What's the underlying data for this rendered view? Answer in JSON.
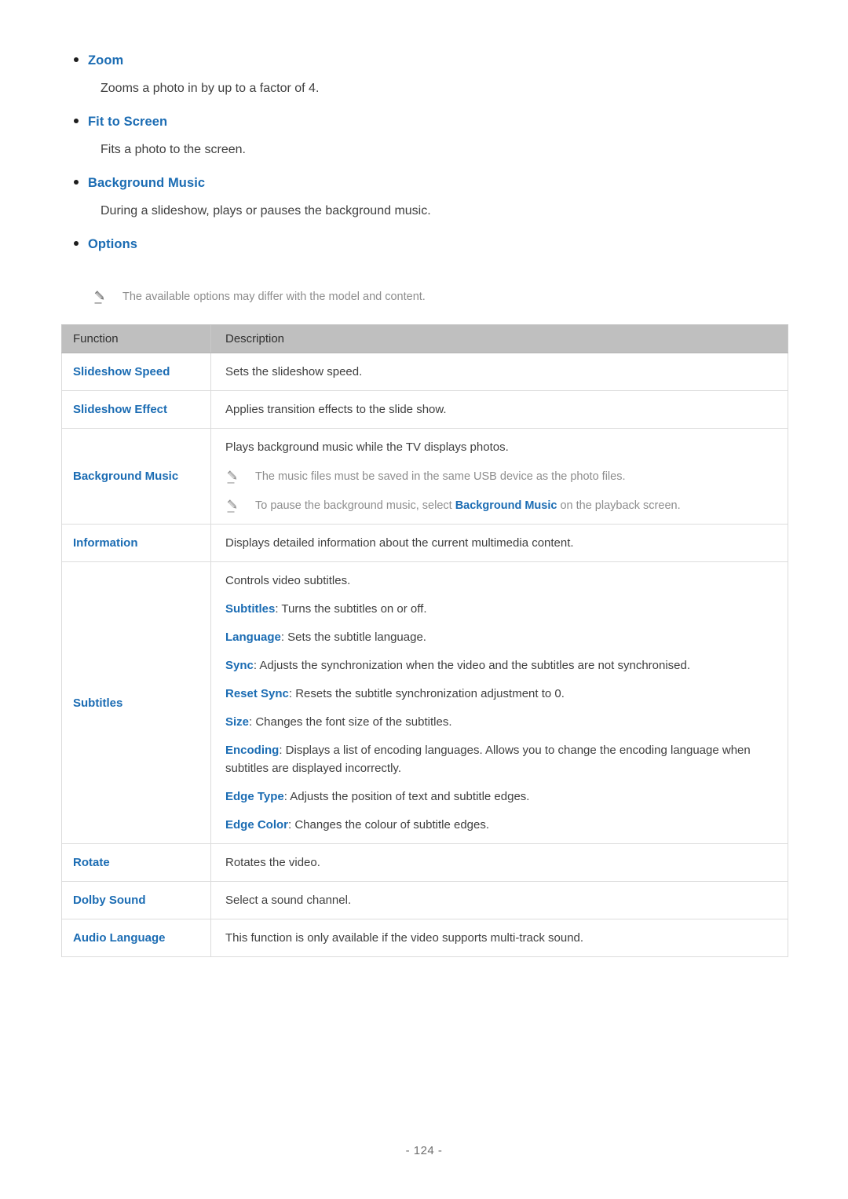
{
  "sections": [
    {
      "heading": "Zoom",
      "description": "Zooms a photo in by up to a factor of 4."
    },
    {
      "heading": "Fit to Screen",
      "description": "Fits a photo to the screen."
    },
    {
      "heading": "Background Music",
      "description": "During a slideshow, plays or pauses the background music."
    },
    {
      "heading": "Options",
      "description": ""
    }
  ],
  "top_note": {
    "icon": "pencil-icon",
    "text": "The available options may differ with the model and content."
  },
  "table": {
    "headers": {
      "function": "Function",
      "description": "Description"
    },
    "rows": [
      {
        "function": "Slideshow Speed",
        "lines": [
          {
            "text": "Sets the slideshow speed."
          }
        ]
      },
      {
        "function": "Slideshow Effect",
        "lines": [
          {
            "text": "Applies transition effects to the slide show."
          }
        ]
      },
      {
        "function": "Background Music",
        "lines": [
          {
            "text": "Plays background music while the TV displays photos."
          },
          {
            "note": true,
            "text": "The music files must be saved in the same USB device as the photo files."
          },
          {
            "note": true,
            "pre": "To pause the background music, select ",
            "kw": "Background Music",
            "post": " on the playback screen."
          }
        ]
      },
      {
        "function": "Information",
        "lines": [
          {
            "text": "Displays detailed information about the current multimedia content."
          }
        ]
      },
      {
        "function": "Subtitles",
        "lines": [
          {
            "text": "Controls video subtitles."
          },
          {
            "kw": "Subtitles",
            "post": ": Turns the subtitles on or off."
          },
          {
            "kw": "Language",
            "post": ": Sets the subtitle language."
          },
          {
            "kw": "Sync",
            "post": ": Adjusts the synchronization when the video and the subtitles are not synchronised."
          },
          {
            "kw": "Reset Sync",
            "post": ": Resets the subtitle synchronization adjustment to 0."
          },
          {
            "kw": "Size",
            "post": ": Changes the font size of the subtitles."
          },
          {
            "kw": "Encoding",
            "post": ": Displays a list of encoding languages. Allows you to change the encoding language when subtitles are displayed incorrectly."
          },
          {
            "kw": "Edge Type",
            "post": ": Adjusts the position of text and subtitle edges."
          },
          {
            "kw": "Edge Color",
            "post": ": Changes the colour of subtitle edges."
          }
        ]
      },
      {
        "function": "Rotate",
        "lines": [
          {
            "text": "Rotates the video."
          }
        ]
      },
      {
        "function": "Dolby Sound",
        "lines": [
          {
            "text": "Select a sound channel."
          }
        ]
      },
      {
        "function": "Audio Language",
        "lines": [
          {
            "text": "This function is only available if the video supports multi-track sound."
          }
        ]
      }
    ]
  },
  "footer": {
    "page_label": "- 124 -"
  },
  "colors": {
    "accent_blue": "#1b6cb3",
    "body_text": "#3f3f3f",
    "note_text": "#8d8d8d",
    "table_header_bg": "#bfbfbf",
    "table_border": "#dcdcdc"
  }
}
